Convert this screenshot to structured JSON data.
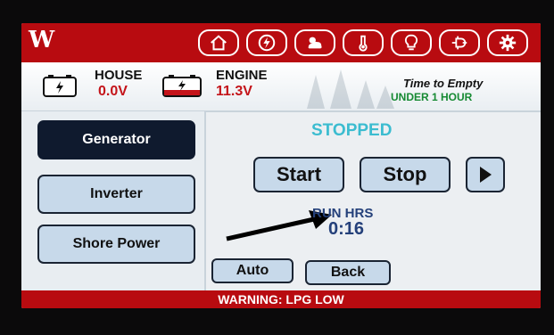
{
  "app": {
    "logo": "W"
  },
  "nav": {
    "items": [
      {
        "name": "home-icon"
      },
      {
        "name": "generator-icon"
      },
      {
        "name": "weather-icon"
      },
      {
        "name": "thermometer-icon"
      },
      {
        "name": "lightbulb-icon"
      },
      {
        "name": "plug-icon"
      },
      {
        "name": "gear-icon"
      }
    ],
    "bar_color": "#b80b10"
  },
  "status": {
    "house": {
      "label": "HOUSE",
      "value": "0.0V"
    },
    "engine": {
      "label": "ENGINE",
      "value": "11.3V"
    },
    "time_to_empty": {
      "label": "Time to Empty",
      "value": "UNDER 1 HOUR"
    }
  },
  "sidebar": {
    "items": [
      {
        "label": "Generator",
        "active": true
      },
      {
        "label": "Inverter",
        "active": false
      },
      {
        "label": "Shore Power",
        "active": false
      }
    ]
  },
  "generator": {
    "state": "STOPPED",
    "start_label": "Start",
    "stop_label": "Stop",
    "next_icon": "play-icon",
    "run_hrs_label": "RUN HRS",
    "run_hrs_value": "0:16",
    "auto_label": "Auto",
    "back_label": "Back"
  },
  "warning": {
    "text": "WARNING: LPG LOW"
  },
  "colors": {
    "accent_red": "#b80b10",
    "status_cyan": "#3bbcd0",
    "button_blue": "#c7d9ea",
    "ok_green": "#168a33"
  }
}
